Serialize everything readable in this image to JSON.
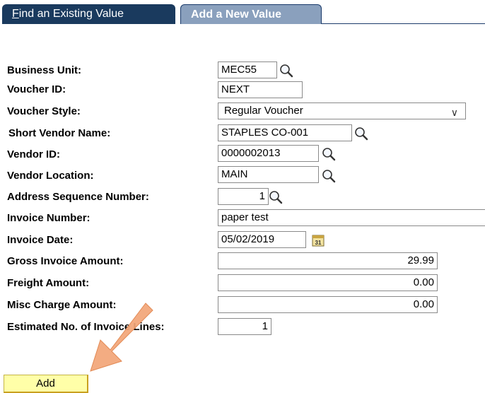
{
  "tabs": {
    "find_prefix": "F",
    "find_rest": "ind an Existing Value",
    "add": "Add a New Value"
  },
  "form": {
    "business_unit": {
      "label": "Business Unit:",
      "value": "MEC55"
    },
    "voucher_id": {
      "label": "Voucher ID:",
      "value": "NEXT"
    },
    "voucher_style": {
      "label": "Voucher Style:",
      "value": "Regular Voucher"
    },
    "short_vendor_name": {
      "label": "Short Vendor Name:",
      "value": "STAPLES CO-001"
    },
    "vendor_id": {
      "label": "Vendor ID:",
      "value": "0000002013"
    },
    "vendor_location": {
      "label": "Vendor Location:",
      "value": "MAIN"
    },
    "address_sequence_number": {
      "label": "Address Sequence Number:",
      "value": "1"
    },
    "invoice_number": {
      "label": "Invoice Number:",
      "value": "paper test"
    },
    "invoice_date": {
      "label": "Invoice Date:",
      "value": "05/02/2019",
      "calendar_day": "31"
    },
    "gross_invoice_amount": {
      "label": "Gross Invoice Amount:",
      "value": "29.99"
    },
    "freight_amount": {
      "label": "Freight Amount:",
      "value": "0.00"
    },
    "misc_charge_amount": {
      "label": "Misc Charge Amount:",
      "value": "0.00"
    },
    "estimated_invoice_lines": {
      "label": "Estimated No. of Invoice Lines:",
      "value": "1"
    }
  },
  "add_button": "Add",
  "icons": {
    "lookup": "magnifier-icon",
    "calendar": "calendar-icon",
    "arrow": "pointer-arrow-icon"
  },
  "colors": {
    "tab_inactive": "#1a3a5e",
    "tab_active": "#8aa0bd",
    "button_bg": "#ffffa8",
    "arrow": "#f0a070"
  }
}
